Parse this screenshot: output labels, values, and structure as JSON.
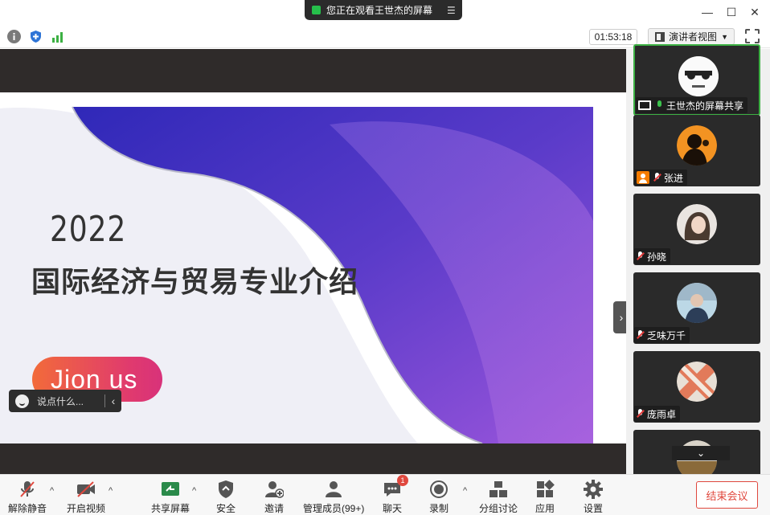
{
  "title_bar": {
    "share_status": "您正在观看王世杰的屏幕",
    "minimize": "—",
    "maximize": "☐",
    "close": "✕"
  },
  "info_bar": {
    "timer": "01:53:18",
    "view_mode": "演讲者视图"
  },
  "slide": {
    "year": "2022",
    "title": "国际经济与贸易专业介绍",
    "cta": "Jion  us"
  },
  "chat": {
    "placeholder": "说点什么..."
  },
  "gallery": {
    "participants": [
      {
        "name": "王世杰的屏幕共享",
        "mic": "live",
        "badge": "screen"
      },
      {
        "name": "张进",
        "mic": "muted",
        "badge": "picture"
      },
      {
        "name": "孙晓",
        "mic": "muted",
        "badge": ""
      },
      {
        "name": "乏味万千",
        "mic": "muted",
        "badge": ""
      },
      {
        "name": "庞雨卓",
        "mic": "muted",
        "badge": ""
      }
    ]
  },
  "toolbar": {
    "unmute": "解除静音",
    "start_video": "开启视频",
    "share_screen": "共享屏幕",
    "security": "安全",
    "invite": "邀请",
    "participants": "管理成员(99+)",
    "chat": "聊天",
    "chat_badge": "1",
    "record": "录制",
    "breakout": "分组讨论",
    "apps": "应用",
    "settings": "设置",
    "end_meeting": "结束会议"
  },
  "colors": {
    "accent_green": "#3cb043",
    "end_red": "#e0483e",
    "slide_purple": "#5a3bc9"
  }
}
